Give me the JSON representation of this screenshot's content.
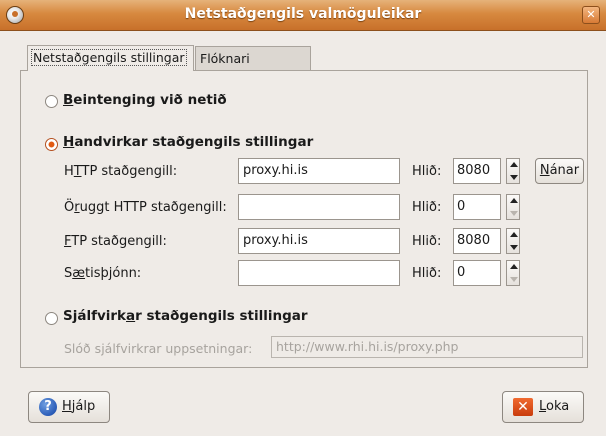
{
  "window": {
    "title": "Netstaðgengils valmöguleikar"
  },
  "tabs": [
    {
      "label": "Netstaðgengils stillingar",
      "active": true
    },
    {
      "label": "Flóknari stillingar",
      "active": false
    }
  ],
  "radios": {
    "direct": {
      "pre": "",
      "u": "B",
      "post": "eintenging við netið",
      "checked": false
    },
    "manual": {
      "pre": "",
      "u": "H",
      "post": "andvirkar staðgengils stillingar",
      "checked": true
    },
    "auto": {
      "pre": "Sjálfvirk",
      "u": "a",
      "post": "r staðgengils stillingar",
      "checked": false
    }
  },
  "proxy_rows": [
    {
      "pre": "H",
      "u": "T",
      "post": "TP staðgengill:",
      "host": "proxy.hi.is",
      "port": "8080",
      "port_label": "Hlið:"
    },
    {
      "pre": "Ö",
      "u": "r",
      "post": "uggt HTTP staðgengill:",
      "host": "",
      "port": "0",
      "port_label": "Hlið:"
    },
    {
      "pre": "",
      "u": "F",
      "post": "TP staðgengill:",
      "host": "proxy.hi.is",
      "port": "8080",
      "port_label": "Hlið:"
    },
    {
      "pre": "S",
      "u": "æ",
      "post": "tisþjónn:",
      "host": "",
      "port": "0",
      "port_label": "Hlið:"
    }
  ],
  "details_button": {
    "u": "N",
    "post": "ánar"
  },
  "autoconfig": {
    "label": "Slóð sjálfvirkrar uppsetningar:",
    "value": "http://www.rhi.hi.is/proxy.php"
  },
  "buttons": {
    "help": {
      "u": "H",
      "post": "jálp"
    },
    "close": {
      "u": "L",
      "post": "oka"
    }
  },
  "colors": {
    "accent": "#e25a12",
    "title_bar": "#d7893f",
    "background": "#efebe7"
  }
}
